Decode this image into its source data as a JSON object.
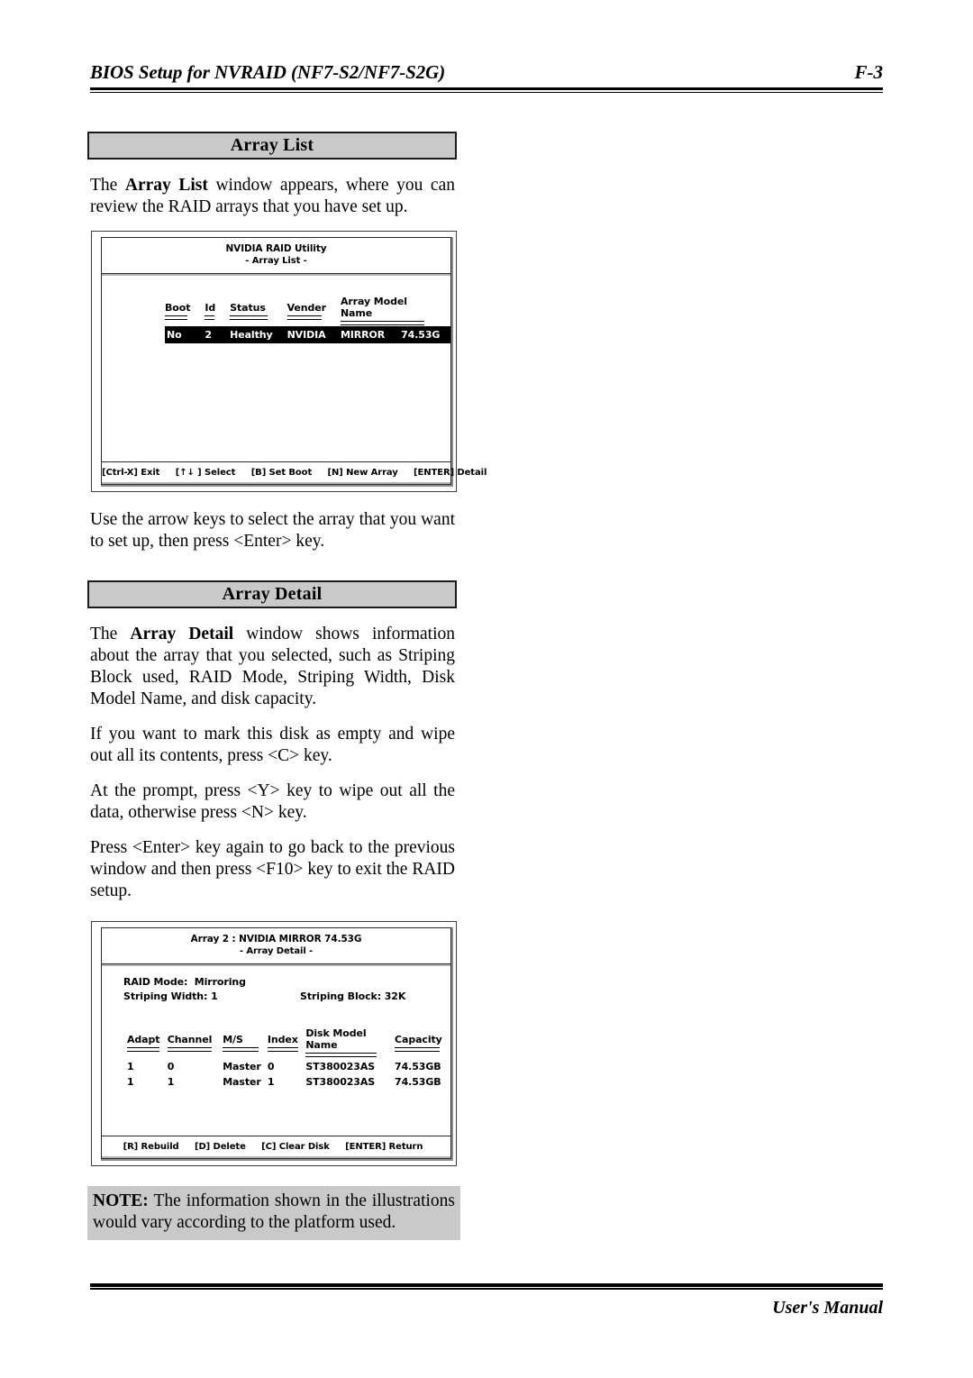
{
  "header": {
    "title": "BIOS Setup for NVRAID (NF7-S2/NF7-S2G)",
    "page_number": "F-3"
  },
  "footer": {
    "text": "User's Manual"
  },
  "sections": [
    {
      "bar_label": "Array List",
      "intro_html": "The <b>Array List</b> window appears, where you can review the RAID arrays that you have set up."
    },
    {
      "bar_label": "Array Detail",
      "intro_html": "The <b>Array Detail</b> window shows information about the array that you selected, such as Striping Block used, RAID Mode, Striping Width, Disk Model Name, and disk capacity."
    }
  ],
  "paragraphs": {
    "after_array_list": "Use the arrow keys to select the array that you want to set up, then press <Enter> key.",
    "wipe": "If you want to mark this disk as empty and wipe out all its contents, press <C> key.",
    "prompt": "At the prompt, press <Y> key to wipe out all the data, otherwise press <N> key.",
    "exit": "Press <Enter> key again to go back to the previous window and then press <F10> key to exit the RAID setup."
  },
  "array_list_screen": {
    "title_line1": "NVIDIA RAID Utility",
    "title_line2": "- Array List -",
    "columns": [
      "Boot",
      "Id",
      "Status",
      "Vender",
      "Array Model Name"
    ],
    "rows": [
      {
        "boot": "No",
        "id": "2",
        "status": "Healthy",
        "vender": "NVIDIA",
        "array_model_name": "MIRROR",
        "capacity": "74.53G",
        "selected": true
      }
    ],
    "footer_keys": [
      "[Ctrl-X] Exit",
      "[↑↓ ] Select",
      "[B] Set Boot",
      "[N] New Array",
      "[ENTER] Detail"
    ]
  },
  "array_detail_screen": {
    "title_line1": "Array 2 : NVIDIA MIRROR 74.53G",
    "title_line2": "- Array Detail -",
    "info": {
      "raid_mode_label": "RAID Mode:",
      "raid_mode_value": "Mirroring",
      "striping_width_label": "Striping Width:",
      "striping_width_value": "1",
      "striping_block_label": "Striping Block:",
      "striping_block_value": "32K"
    },
    "columns": [
      "Adapt",
      "Channel",
      "M/S",
      "Index",
      "Disk Model Name",
      "Capacity"
    ],
    "rows": [
      {
        "adapt": "1",
        "channel": "0",
        "ms": "Master",
        "index": "0",
        "model": "ST380023AS",
        "capacity": "74.53GB"
      },
      {
        "adapt": "1",
        "channel": "1",
        "ms": "Master",
        "index": "1",
        "model": "ST380023AS",
        "capacity": "74.53GB"
      }
    ],
    "footer_keys": [
      "[R] Rebuild",
      "[D] Delete",
      "[C] Clear Disk",
      "[ENTER] Return"
    ]
  },
  "note": {
    "prefix": "NOTE:",
    "body": "The information shown in the illustrations would vary according to the platform used."
  },
  "colors": {
    "bar_background": "#c9c9c9",
    "note_background": "#c9c9c9",
    "selection_background": "#000000",
    "selection_foreground": "#ffffff"
  }
}
